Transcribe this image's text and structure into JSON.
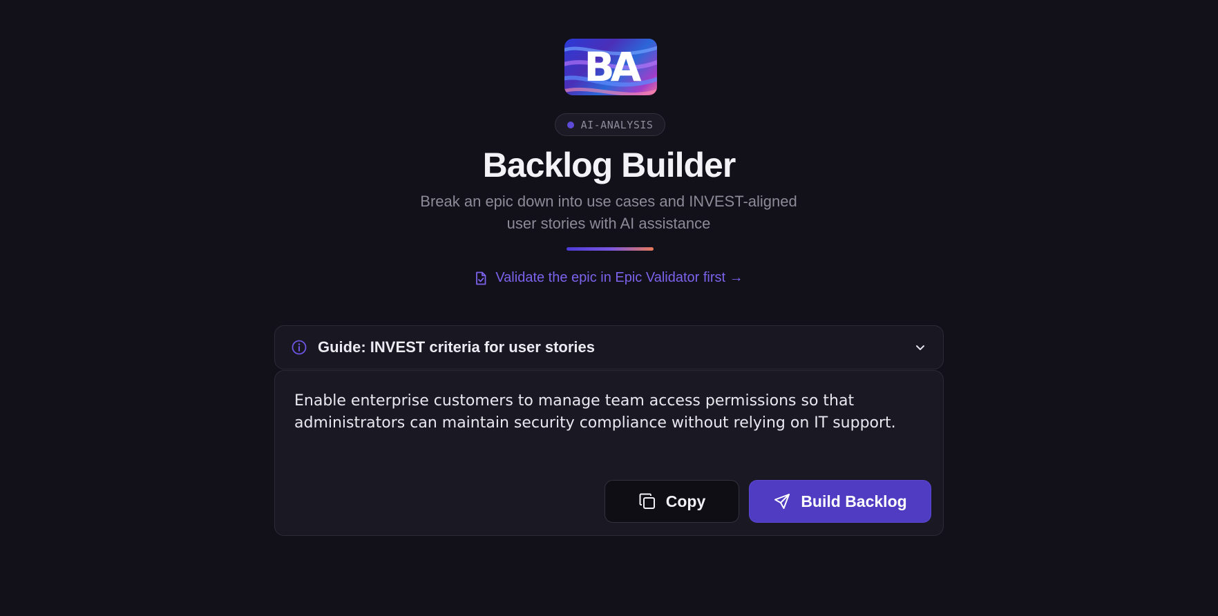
{
  "logo": {
    "text": "BA"
  },
  "badge": {
    "text": "AI-ANALYSIS"
  },
  "header": {
    "title": "Backlog Builder",
    "subtitle_line1": "Break an epic down into use cases and INVEST-aligned",
    "subtitle_line2": "user stories with AI assistance"
  },
  "validate_link": {
    "label": "Validate the epic in Epic Validator first →"
  },
  "guide": {
    "label": "Guide: INVEST criteria for user stories"
  },
  "epic": {
    "text": "Enable enterprise customers to manage team access permissions so that administrators can maintain security compliance without relying on IT support."
  },
  "actions": {
    "copy_label": "Copy",
    "build_label": "Build Backlog"
  },
  "colors": {
    "background": "#121019",
    "accent": "#4f3cc2",
    "link": "#7c63ec"
  },
  "icons": {
    "validate": "file-check-icon",
    "guide": "info-icon",
    "chevron": "chevron-down-icon",
    "copy": "copy-icon",
    "build": "send-icon"
  }
}
